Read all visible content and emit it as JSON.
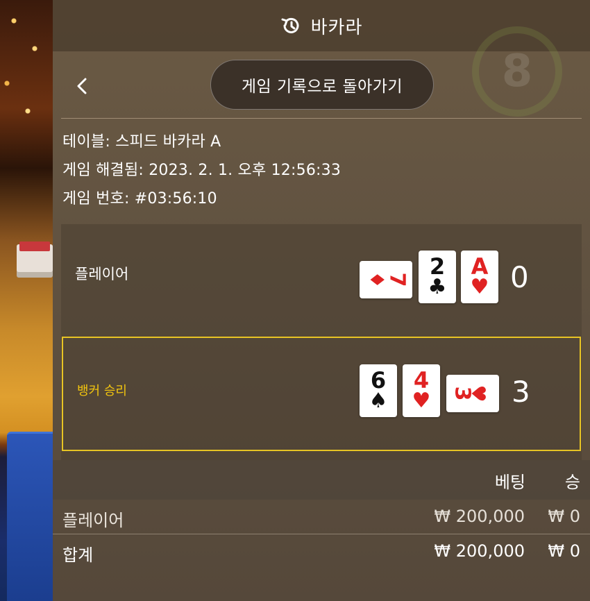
{
  "header": {
    "title": "바카라",
    "icon": "history-icon"
  },
  "nav": {
    "back_icon": "chevron-left-icon",
    "back_to_history_label": "게임 기록으로 돌아가기",
    "background_badge": "8"
  },
  "game_info": {
    "table": "테이블: 스피드 바카라 A",
    "resolved": "게임 해결됨: 2023. 2. 1. 오후 12:56:33",
    "game_number": "게임 번호: #03:56:10"
  },
  "hands": {
    "player": {
      "label": "플레이어",
      "score": "0",
      "cards": [
        {
          "rank": "7",
          "suit": "♦",
          "color": "red",
          "orientation": "sideways"
        },
        {
          "rank": "2",
          "suit": "♣",
          "color": "black",
          "orientation": "upright"
        },
        {
          "rank": "A",
          "suit": "♥",
          "color": "red",
          "orientation": "upright"
        }
      ]
    },
    "banker": {
      "label": "뱅커 승리",
      "score": "3",
      "highlight_color": "#e8c424",
      "cards": [
        {
          "rank": "6",
          "suit": "♠",
          "color": "black",
          "orientation": "upright"
        },
        {
          "rank": "4",
          "suit": "♥",
          "color": "red",
          "orientation": "upright"
        },
        {
          "rank": "3",
          "suit": "♥",
          "color": "red",
          "orientation": "sideways"
        }
      ]
    }
  },
  "bets": {
    "headers": {
      "bet": "베팅",
      "win": "승"
    },
    "rows": [
      {
        "label": "플레이어",
        "bet": "₩ 200,000",
        "win": "₩ 0"
      }
    ],
    "total": {
      "label": "합계",
      "bet": "₩ 200,000",
      "win": "₩ 0"
    }
  },
  "colors": {
    "panel": "#5f5140",
    "accent_gold": "#e8c424",
    "card_red": "#e02222"
  }
}
